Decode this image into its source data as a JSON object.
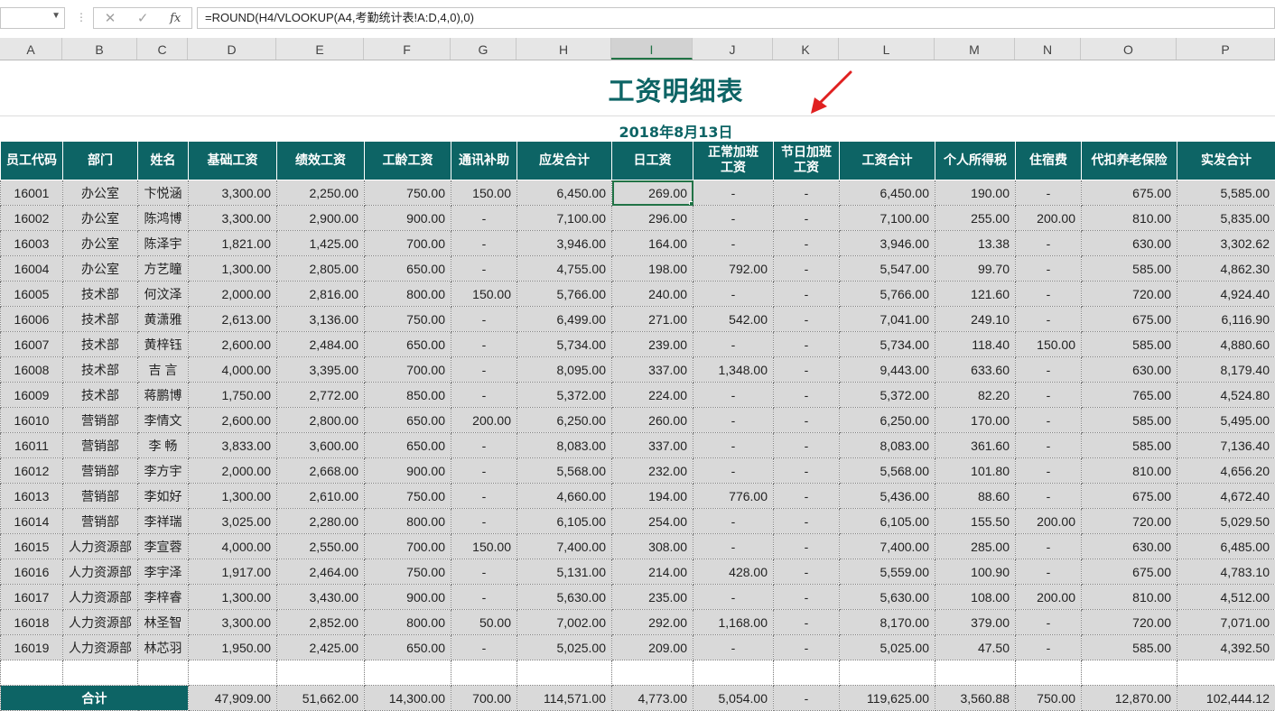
{
  "formula_bar": {
    "cancel_icon": "✕",
    "enter_icon": "✓",
    "fx_label": "fx",
    "formula": "=ROUND(H4/VLOOKUP(A4,考勤统计表!A:D,4,0),0)"
  },
  "columns": [
    "A",
    "B",
    "C",
    "D",
    "E",
    "F",
    "G",
    "H",
    "I",
    "J",
    "K",
    "L",
    "M",
    "N",
    "O",
    "P"
  ],
  "selected_column": "I",
  "sheet": {
    "title": "工资明细表",
    "date": "2018年8月13日",
    "headers": [
      "员工代码",
      "部门",
      "姓名",
      "基础工资",
      "绩效工资",
      "工龄工资",
      "通讯补助",
      "应发合计",
      "日工资",
      "正常加班\n工资",
      "节日加班\n工资",
      "工资合计",
      "个人所得税",
      "住宿费",
      "代扣养老保险",
      "实发合计"
    ],
    "rows": [
      [
        "16001",
        "办公室",
        "卞悦涵",
        "3,300.00",
        "2,250.00",
        "750.00",
        "150.00",
        "6,450.00",
        "269.00",
        "-",
        "-",
        "6,450.00",
        "190.00",
        "-",
        "675.00",
        "5,585.00"
      ],
      [
        "16002",
        "办公室",
        "陈鸿博",
        "3,300.00",
        "2,900.00",
        "900.00",
        "-",
        "7,100.00",
        "296.00",
        "-",
        "-",
        "7,100.00",
        "255.00",
        "200.00",
        "810.00",
        "5,835.00"
      ],
      [
        "16003",
        "办公室",
        "陈泽宇",
        "1,821.00",
        "1,425.00",
        "700.00",
        "-",
        "3,946.00",
        "164.00",
        "-",
        "-",
        "3,946.00",
        "13.38",
        "-",
        "630.00",
        "3,302.62"
      ],
      [
        "16004",
        "办公室",
        "方艺瞳",
        "1,300.00",
        "2,805.00",
        "650.00",
        "-",
        "4,755.00",
        "198.00",
        "792.00",
        "-",
        "5,547.00",
        "99.70",
        "-",
        "585.00",
        "4,862.30"
      ],
      [
        "16005",
        "技术部",
        "何汶泽",
        "2,000.00",
        "2,816.00",
        "800.00",
        "150.00",
        "5,766.00",
        "240.00",
        "-",
        "-",
        "5,766.00",
        "121.60",
        "-",
        "720.00",
        "4,924.40"
      ],
      [
        "16006",
        "技术部",
        "黄潇雅",
        "2,613.00",
        "3,136.00",
        "750.00",
        "-",
        "6,499.00",
        "271.00",
        "542.00",
        "-",
        "7,041.00",
        "249.10",
        "-",
        "675.00",
        "6,116.90"
      ],
      [
        "16007",
        "技术部",
        "黄梓钰",
        "2,600.00",
        "2,484.00",
        "650.00",
        "-",
        "5,734.00",
        "239.00",
        "-",
        "-",
        "5,734.00",
        "118.40",
        "150.00",
        "585.00",
        "4,880.60"
      ],
      [
        "16008",
        "技术部",
        "吉 言",
        "4,000.00",
        "3,395.00",
        "700.00",
        "-",
        "8,095.00",
        "337.00",
        "1,348.00",
        "-",
        "9,443.00",
        "633.60",
        "-",
        "630.00",
        "8,179.40"
      ],
      [
        "16009",
        "技术部",
        "蒋鹏博",
        "1,750.00",
        "2,772.00",
        "850.00",
        "-",
        "5,372.00",
        "224.00",
        "-",
        "-",
        "5,372.00",
        "82.20",
        "-",
        "765.00",
        "4,524.80"
      ],
      [
        "16010",
        "营销部",
        "李情文",
        "2,600.00",
        "2,800.00",
        "650.00",
        "200.00",
        "6,250.00",
        "260.00",
        "-",
        "-",
        "6,250.00",
        "170.00",
        "-",
        "585.00",
        "5,495.00"
      ],
      [
        "16011",
        "营销部",
        "李 畅",
        "3,833.00",
        "3,600.00",
        "650.00",
        "-",
        "8,083.00",
        "337.00",
        "-",
        "-",
        "8,083.00",
        "361.60",
        "-",
        "585.00",
        "7,136.40"
      ],
      [
        "16012",
        "营销部",
        "李方宇",
        "2,000.00",
        "2,668.00",
        "900.00",
        "-",
        "5,568.00",
        "232.00",
        "-",
        "-",
        "5,568.00",
        "101.80",
        "-",
        "810.00",
        "4,656.20"
      ],
      [
        "16013",
        "营销部",
        "李如好",
        "1,300.00",
        "2,610.00",
        "750.00",
        "-",
        "4,660.00",
        "194.00",
        "776.00",
        "-",
        "5,436.00",
        "88.60",
        "-",
        "675.00",
        "4,672.40"
      ],
      [
        "16014",
        "营销部",
        "李祥瑞",
        "3,025.00",
        "2,280.00",
        "800.00",
        "-",
        "6,105.00",
        "254.00",
        "-",
        "-",
        "6,105.00",
        "155.50",
        "200.00",
        "720.00",
        "5,029.50"
      ],
      [
        "16015",
        "人力资源部",
        "李宣蓉",
        "4,000.00",
        "2,550.00",
        "700.00",
        "150.00",
        "7,400.00",
        "308.00",
        "-",
        "-",
        "7,400.00",
        "285.00",
        "-",
        "630.00",
        "6,485.00"
      ],
      [
        "16016",
        "人力资源部",
        "李宇泽",
        "1,917.00",
        "2,464.00",
        "750.00",
        "-",
        "5,131.00",
        "214.00",
        "428.00",
        "-",
        "5,559.00",
        "100.90",
        "-",
        "675.00",
        "4,783.10"
      ],
      [
        "16017",
        "人力资源部",
        "李梓睿",
        "1,300.00",
        "3,430.00",
        "900.00",
        "-",
        "5,630.00",
        "235.00",
        "-",
        "-",
        "5,630.00",
        "108.00",
        "200.00",
        "810.00",
        "4,512.00"
      ],
      [
        "16018",
        "人力资源部",
        "林圣智",
        "3,300.00",
        "2,852.00",
        "800.00",
        "50.00",
        "7,002.00",
        "292.00",
        "1,168.00",
        "-",
        "8,170.00",
        "379.00",
        "-",
        "720.00",
        "7,071.00"
      ],
      [
        "16019",
        "人力资源部",
        "林芯羽",
        "1,950.00",
        "2,425.00",
        "650.00",
        "-",
        "5,025.00",
        "209.00",
        "-",
        "-",
        "5,025.00",
        "47.50",
        "-",
        "585.00",
        "4,392.50"
      ]
    ],
    "total_label": "合计",
    "totals": [
      "47,909.00",
      "51,662.00",
      "14,300.00",
      "700.00",
      "114,571.00",
      "4,773.00",
      "5,054.00",
      "-",
      "119,625.00",
      "3,560.88",
      "750.00",
      "12,870.00",
      "102,444.12"
    ]
  },
  "colors": {
    "header_teal": "#0d6465",
    "cell_gray": "#d9d9d9",
    "excel_green": "#217346",
    "arrow_red": "#e02020"
  }
}
